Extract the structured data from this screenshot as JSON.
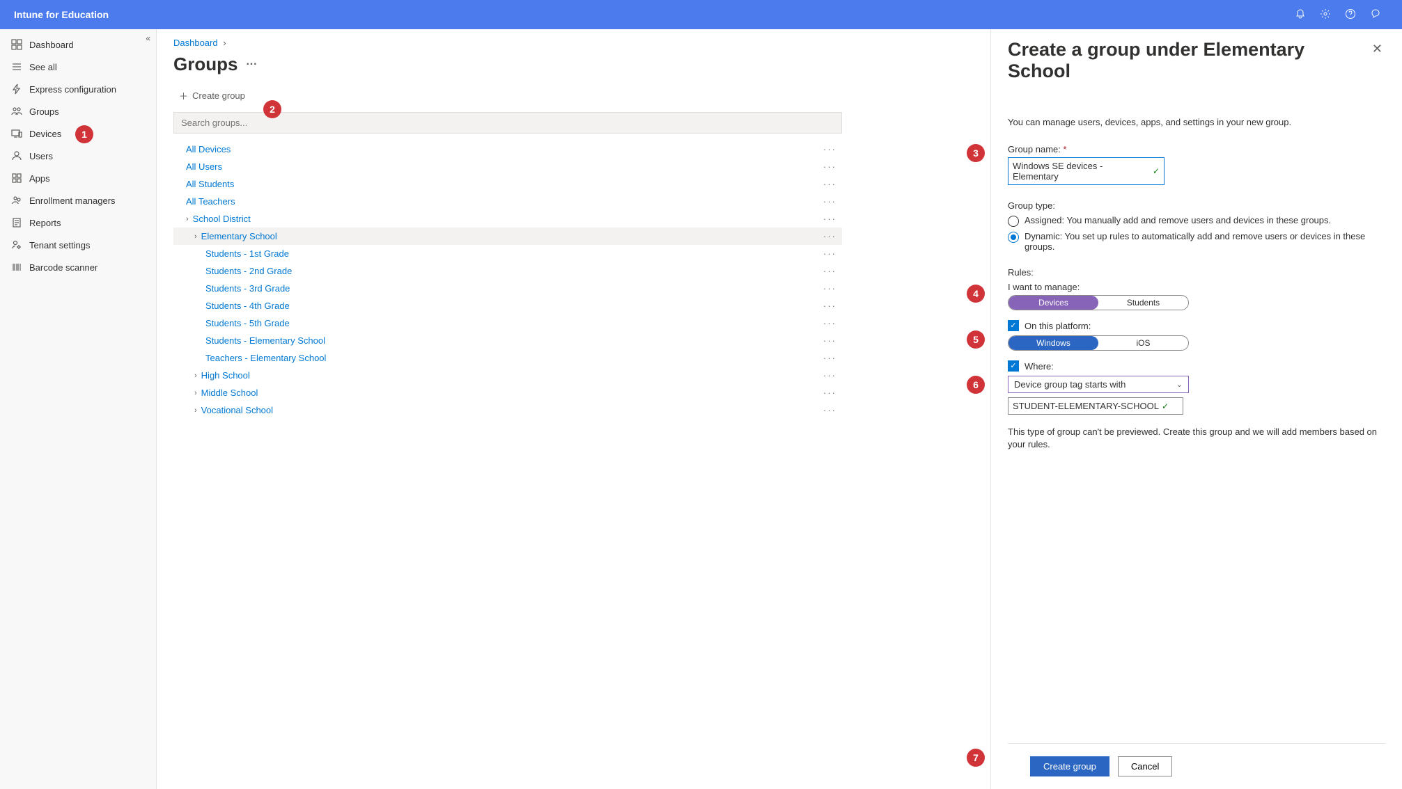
{
  "header": {
    "app_title": "Intune for Education"
  },
  "nav": {
    "items": [
      {
        "label": "Dashboard"
      },
      {
        "label": "See all"
      },
      {
        "label": "Express configuration"
      },
      {
        "label": "Groups"
      },
      {
        "label": "Devices"
      },
      {
        "label": "Users"
      },
      {
        "label": "Apps"
      },
      {
        "label": "Enrollment managers"
      },
      {
        "label": "Reports"
      },
      {
        "label": "Tenant settings"
      },
      {
        "label": "Barcode scanner"
      }
    ]
  },
  "breadcrumb": {
    "item0": "Dashboard"
  },
  "page": {
    "title": "Groups",
    "create_label": "Create group",
    "search_placeholder": "Search groups..."
  },
  "tree": {
    "r0": "All Devices",
    "r1": "All Users",
    "r2": "All Students",
    "r3": "All Teachers",
    "r4": "School District",
    "r5": "Elementary School",
    "r6": "Students - 1st Grade",
    "r7": "Students - 2nd Grade",
    "r8": "Students - 3rd Grade",
    "r9": "Students - 4th Grade",
    "r10": "Students - 5th Grade",
    "r11": "Students - Elementary School",
    "r12": "Teachers - Elementary School",
    "r13": "High School",
    "r14": "Middle School",
    "r15": "Vocational School"
  },
  "panel": {
    "title": "Create a group under Elementary School",
    "helper": "You can manage users, devices, apps, and settings in your new group.",
    "group_name_label": "Group name:",
    "group_name_value": "Windows SE devices - Elementary",
    "group_type_label": "Group type:",
    "assigned_label": "Assigned: You manually add and remove users and devices in these groups.",
    "dynamic_label": "Dynamic: You set up rules to automatically add and remove users or devices in these groups.",
    "rules_label": "Rules:",
    "manage_label": "I want to manage:",
    "manage_opt_devices": "Devices",
    "manage_opt_students": "Students",
    "platform_label": "On this platform:",
    "platform_opt_windows": "Windows",
    "platform_opt_ios": "iOS",
    "where_label": "Where:",
    "where_select": "Device group tag starts with",
    "where_value": "STUDENT-ELEMENTARY-SCHOOL",
    "note": "This type of group can't be previewed. Create this group and we will add members based on your rules.",
    "create_btn": "Create group",
    "cancel_btn": "Cancel"
  },
  "hints": {
    "h1": "1",
    "h2": "2",
    "h3": "3",
    "h4": "4",
    "h5": "5",
    "h6": "6",
    "h7": "7"
  }
}
